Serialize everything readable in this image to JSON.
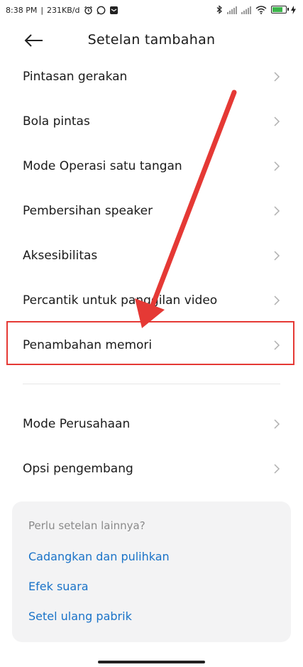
{
  "status_bar": {
    "time": "8:38 PM",
    "separator": "|",
    "net_speed": "231KB/d"
  },
  "header": {
    "title": "Setelan tambahan"
  },
  "settings": {
    "items": [
      {
        "label": "Pintasan gerakan"
      },
      {
        "label": "Bola pintas"
      },
      {
        "label": "Mode Operasi satu tangan"
      },
      {
        "label": "Pembersihan speaker"
      },
      {
        "label": "Aksesibilitas"
      },
      {
        "label": "Percantik untuk panggilan video"
      },
      {
        "label": "Penambahan memori"
      }
    ],
    "items2": [
      {
        "label": "Mode Perusahaan"
      },
      {
        "label": "Opsi pengembang"
      }
    ]
  },
  "more_card": {
    "title": "Perlu setelan lainnya?",
    "links": [
      "Cadangkan dan pulihkan",
      "Efek suara",
      "Setel ulang pabrik"
    ]
  },
  "colors": {
    "accent_link": "#1a73c8",
    "highlight": "#e53935"
  },
  "icons": [
    "alarm-icon",
    "whatsapp-icon",
    "mail-icon",
    "bluetooth-icon",
    "signal-icon",
    "wifi-icon",
    "battery-icon",
    "charging-icon",
    "back-arrow-icon",
    "chevron-right-icon"
  ]
}
